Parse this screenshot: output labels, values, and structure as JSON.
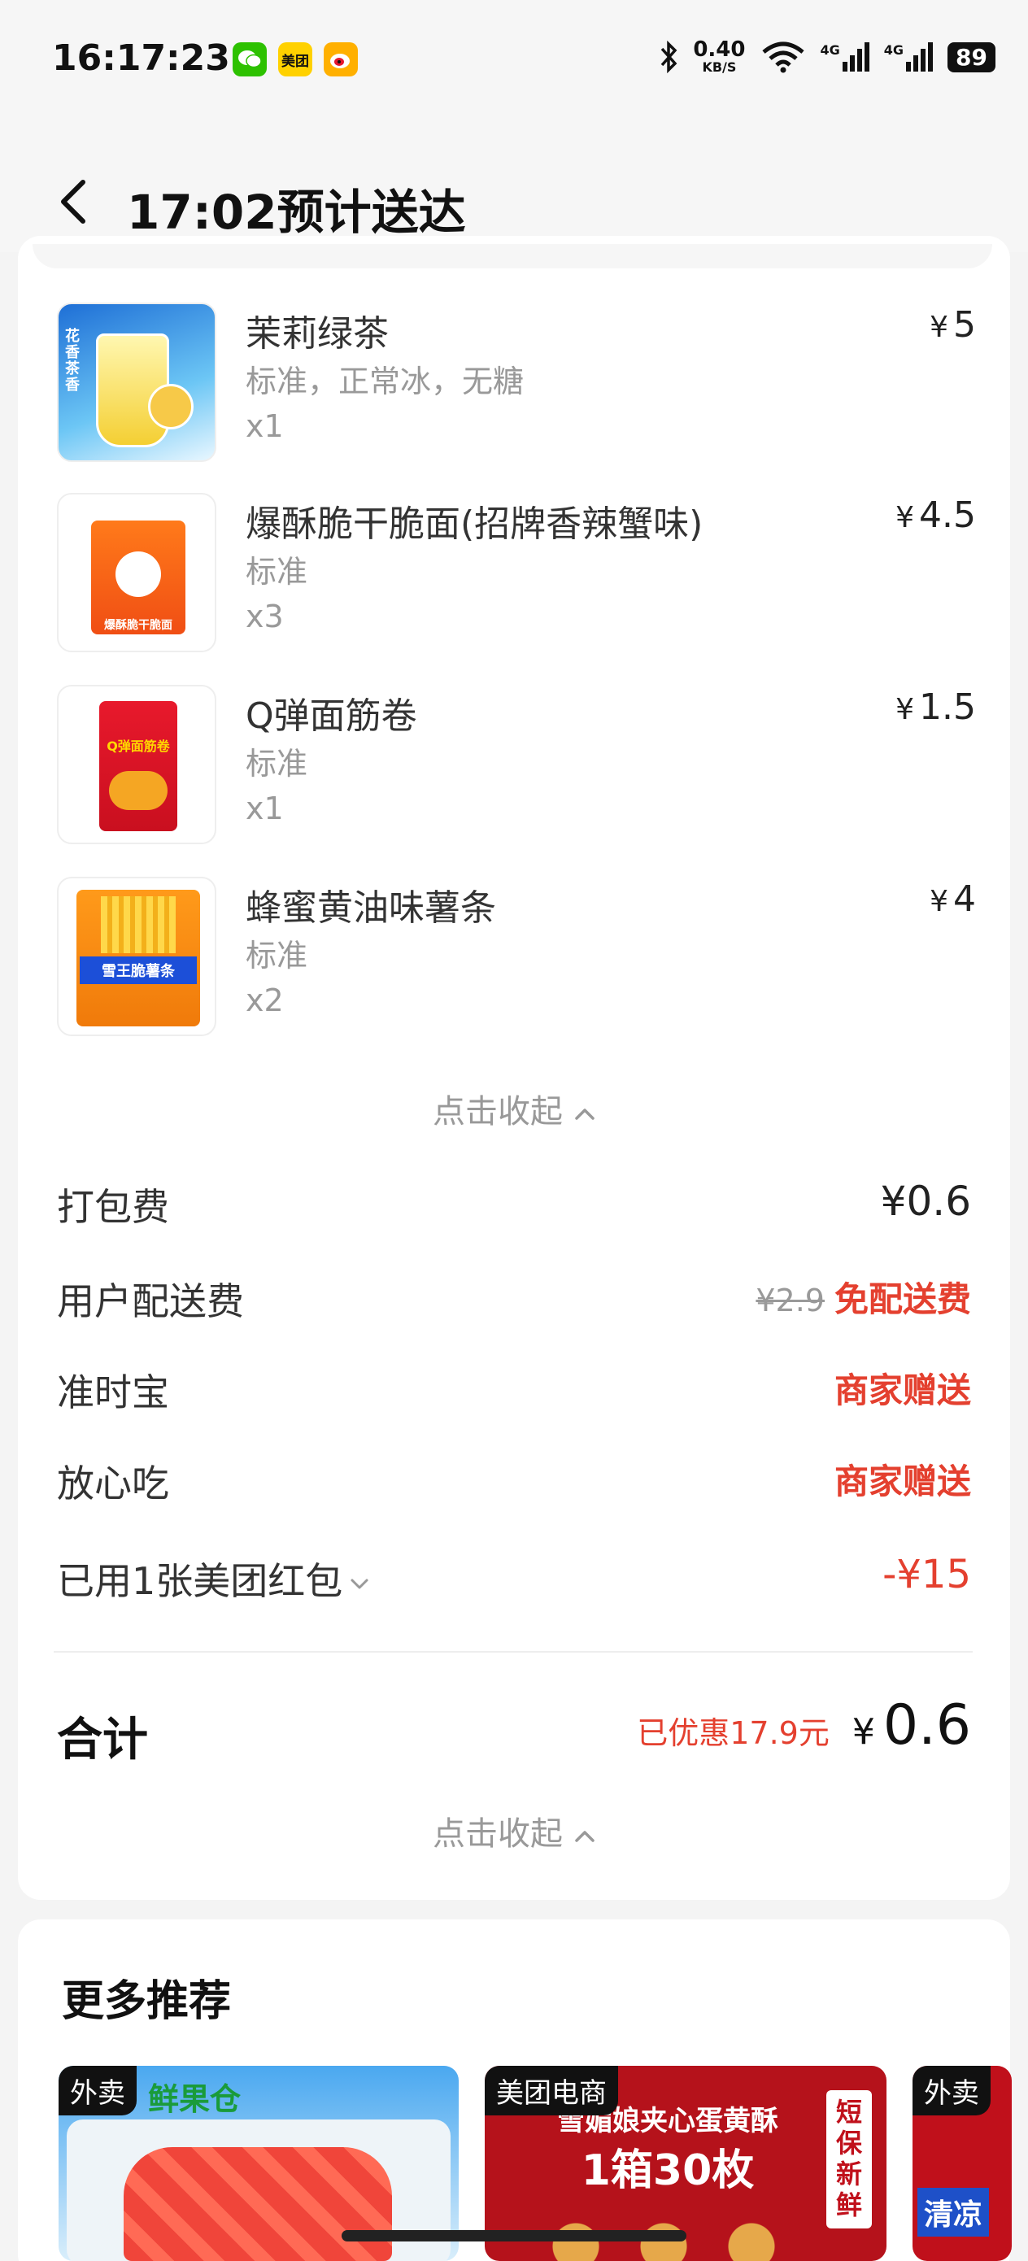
{
  "status_bar": {
    "time": "16:17:23",
    "apps": [
      "微信",
      "美团",
      "微博"
    ],
    "net_speed": "0.40",
    "net_unit": "KB/S",
    "signal1": "4G",
    "signal2": "4G",
    "battery": "89"
  },
  "header": {
    "title": "17:02预计送达"
  },
  "items": [
    {
      "name": "茉莉绿茶",
      "spec": "标准，正常冰，无糖",
      "qty": "x1",
      "price": "5",
      "currency": "¥",
      "thumb_text": "花香茶香"
    },
    {
      "name": "爆酥脆干脆面(招牌香辣蟹味)",
      "spec": "标准",
      "qty": "x3",
      "price": "4.5",
      "currency": "¥",
      "thumb_text": "爆酥脆干脆面"
    },
    {
      "name": "Q弹面筋卷",
      "spec": "标准",
      "qty": "x1",
      "price": "1.5",
      "currency": "¥",
      "thumb_text": "Q弹面筋卷"
    },
    {
      "name": "蜂蜜黄油味薯条",
      "spec": "标准",
      "qty": "x2",
      "price": "4",
      "currency": "¥",
      "thumb_text": "雪王脆薯条"
    }
  ],
  "collapse_label": "点击收起",
  "fees": {
    "packing": {
      "label": "打包费",
      "value": "¥0.6"
    },
    "delivery": {
      "label": "用户配送费",
      "original": "¥2.9",
      "value": "免配送费"
    },
    "ontime": {
      "label": "准时宝",
      "value": "商家赠送"
    },
    "safe": {
      "label": "放心吃",
      "value": "商家赠送"
    },
    "redpacket": {
      "label": "已用1张美团红包",
      "value": "-¥15"
    }
  },
  "total": {
    "label": "合计",
    "saved": "已优惠17.9元",
    "currency": "¥",
    "value": "0.6"
  },
  "recommend": {
    "title": "更多推荐",
    "cards": [
      {
        "tag": "外卖",
        "banner": "鲜果仓"
      },
      {
        "tag": "美团电商",
        "banner": "雪媚娘夹心蛋黄酥",
        "sub": "1箱30枚",
        "side": "短保新鲜"
      },
      {
        "tag": "外卖",
        "banner": "清凉"
      }
    ]
  },
  "colors": {
    "accent_red": "#e4402f",
    "text_gray": "#999999"
  }
}
